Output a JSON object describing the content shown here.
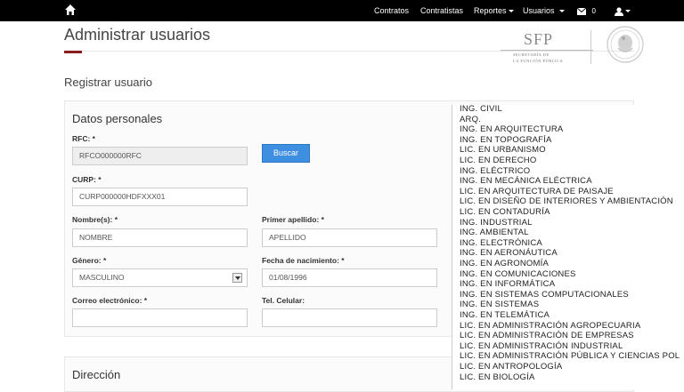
{
  "nav": {
    "items": [
      {
        "label": "Contratos",
        "caret": false
      },
      {
        "label": "Contratistas",
        "caret": false
      },
      {
        "label": "Reportes",
        "caret": true
      },
      {
        "label": "Usuarios",
        "caret": true
      }
    ],
    "mail_count": "0",
    "icons": [
      "home-icon",
      "envelope-icon",
      "user-icon"
    ]
  },
  "page": {
    "title": "Administrar usuarios",
    "section": "Registrar usuario"
  },
  "logo": {
    "main": "SFP",
    "line1": "SECRETARÍA DE",
    "line2": "LA FUNCIÓN PÚBLICA"
  },
  "form": {
    "panel_title": "Datos personales",
    "rfc_label": "RFC: *",
    "rfc_value": "RFCO000000RFC",
    "search_label": "Buscar",
    "curp_label": "CURP: *",
    "curp_value": "CURP000000HDFXXX01",
    "nombre_label": "Nombre(s): *",
    "nombre_value": "NOMBRE",
    "apellido_label": "Primer apellido: *",
    "apellido_value": "APELLIDO",
    "genero_label": "Género: *",
    "genero_value": "MASCULINO",
    "fecha_label": "Fecha de nacimiento: *",
    "fecha_value": "01/08/1996",
    "correo_label": "Correo electrónico: *",
    "correo_value": "",
    "tel_label": "Tel. Celular:",
    "tel_value": ""
  },
  "address": {
    "panel_title": "Dirección"
  },
  "dropdown": {
    "options": [
      "ING. CIVIL",
      "ARQ.",
      "ING. EN ARQUITECTURA",
      "ING. EN TOPOGRAFÍA",
      "LIC. EN URBANISMO",
      "LIC. EN DERECHO",
      "ING. ELÉCTRICO",
      "ING. EN MECÁNICA ELÉCTRICA",
      "LIC. EN ARQUITECTURA DE PAISAJE",
      "LIC. EN DISEÑO DE INTERIORES Y AMBIENTACIÓN",
      "LIC. EN CONTADURÍA",
      "ING. INDUSTRIAL",
      "ING. AMBIENTAL",
      "ING. ELECTRÓNICA",
      "ING. EN AERONÁUTICA",
      "ING. EN AGRONOMÍA",
      "ING. EN COMUNICACIONES",
      "ING. EN INFORMÁTICA",
      "ING. EN SISTEMAS COMPUTACIONALES",
      "ING. EN SISTEMAS",
      "ING. EN TELEMÁTICA",
      "LIC. EN ADMINISTRACIÓN AGROPECUARIA",
      "LIC. EN ADMINISTRACIÓN DE EMPRESAS",
      "LIC. EN ADMINISTRACIÓN INDUSTRIAL",
      "LIC. EN ADMINISTRACIÓN PÚBLICA Y CIENCIAS POL",
      "LIC. EN ANTROPOLOGÍA",
      "LIC. EN BIOLOGÍA"
    ]
  },
  "colors": {
    "topbar": "#000000",
    "accent_red": "#8b1c1c",
    "button_blue": "#3f8fe0"
  }
}
